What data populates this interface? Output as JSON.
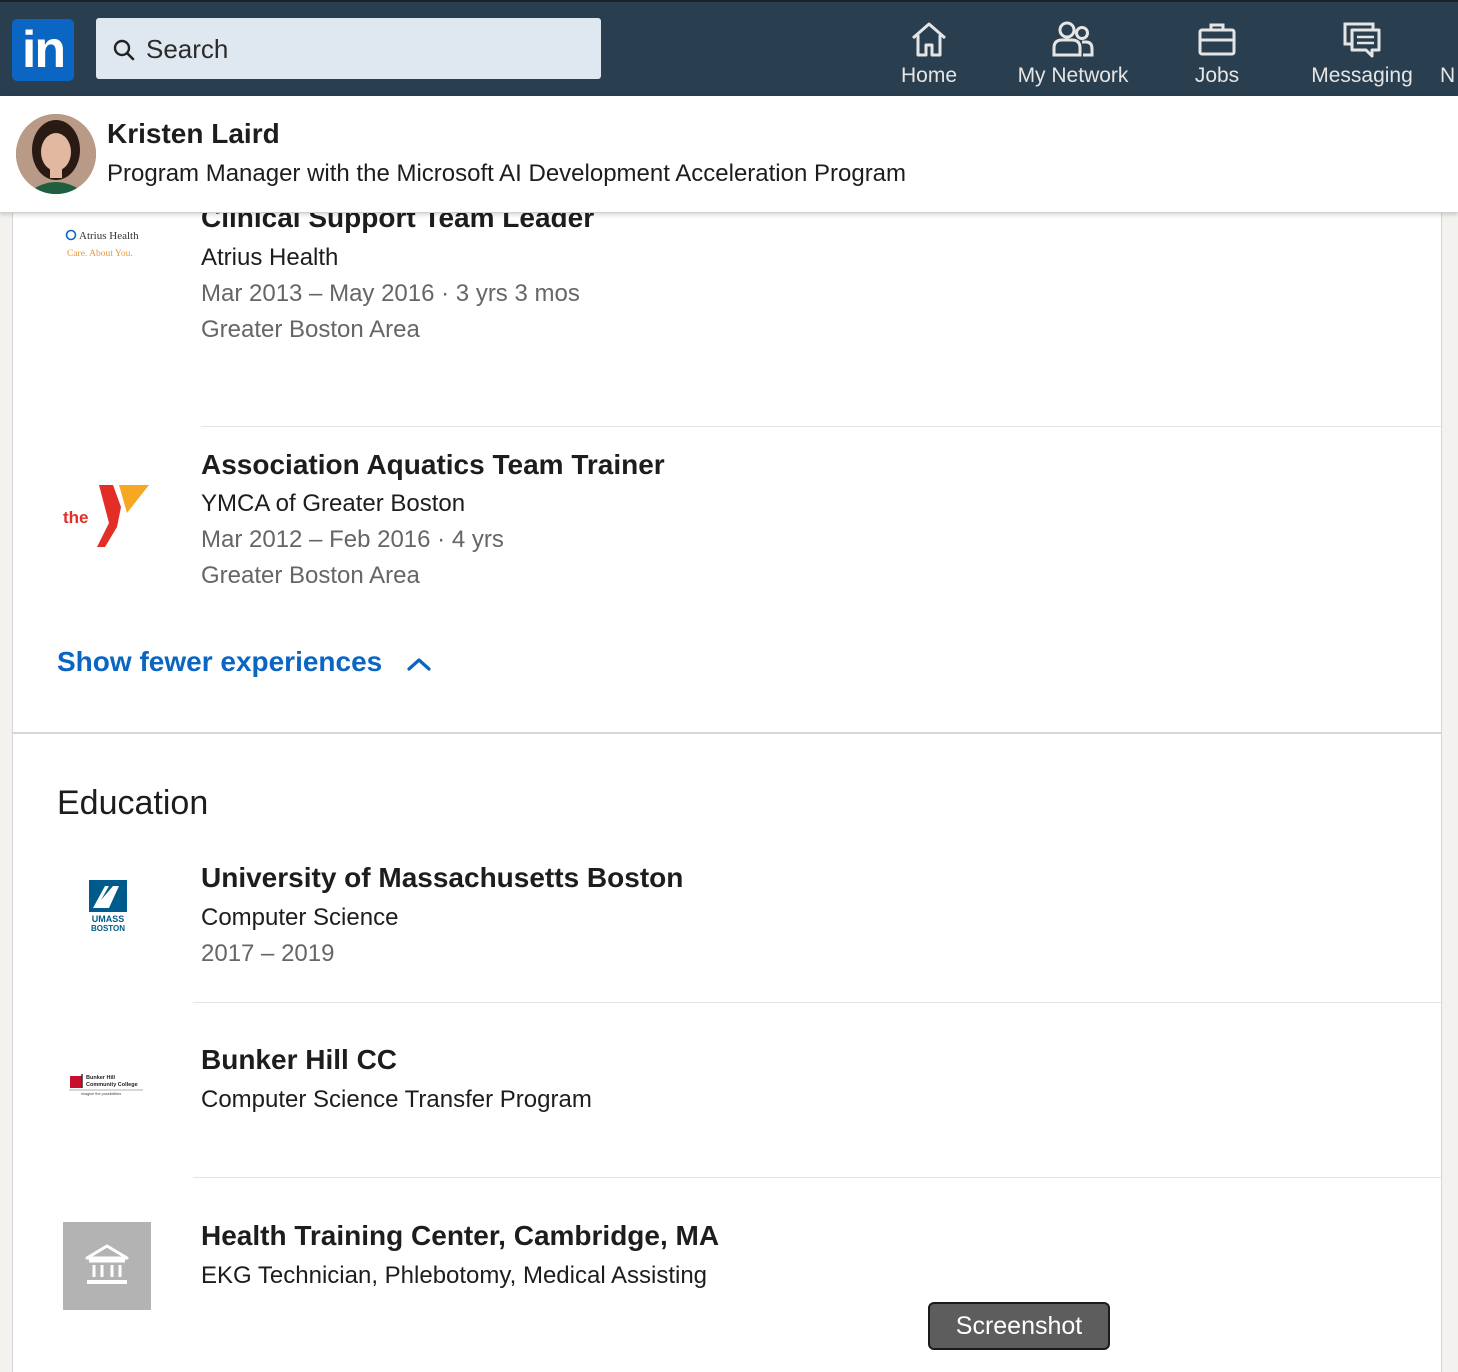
{
  "nav": {
    "logo_text": "in",
    "search_placeholder": "Search",
    "items": [
      {
        "label": "Home",
        "icon": "home-icon"
      },
      {
        "label": "My Network",
        "icon": "network-icon"
      },
      {
        "label": "Jobs",
        "icon": "briefcase-icon"
      },
      {
        "label": "Messaging",
        "icon": "messaging-icon"
      },
      {
        "label": "N",
        "icon": ""
      }
    ]
  },
  "profile": {
    "name": "Kristen Laird",
    "headline": "Program Manager with the Microsoft AI Development Acceleration Program"
  },
  "experience": {
    "items": [
      {
        "title": "Clinical Support Team Leader",
        "company": "Atrius Health",
        "dates": "Mar 2013 – May 2016 · 3 yrs 3 mos",
        "location": "Greater Boston Area",
        "logo_lines": [
          "Atrius Health",
          "Care. About You."
        ]
      },
      {
        "title": "Association Aquatics Team Trainer",
        "company": "YMCA of Greater Boston",
        "dates": "Mar 2012 – Feb 2016 · 4 yrs",
        "location": "Greater Boston Area",
        "logo_text": "the"
      }
    ],
    "show_fewer_label": "Show fewer experiences"
  },
  "education": {
    "title": "Education",
    "items": [
      {
        "school": "University of Massachusetts Boston",
        "degree": "Computer Science",
        "dates": "2017 – 2019",
        "logo_lines": [
          "UMASS",
          "BOSTON"
        ]
      },
      {
        "school": "Bunker Hill CC",
        "degree": "Computer Science Transfer Program",
        "logo_lines": [
          "Bunker Hill",
          "Community College",
          "imagine the possibilities"
        ]
      },
      {
        "school": "Health Training Center, Cambridge, MA",
        "degree": "EKG Technician, Phlebotomy, Medical Assisting"
      }
    ]
  },
  "tooltip": {
    "label": "Screenshot"
  },
  "colors": {
    "nav_bg": "#293e4f",
    "brand_blue": "#0a66c2",
    "ymca_red": "#e32d27",
    "ymca_orange": "#f7a823",
    "umass_blue": "#005a8b"
  }
}
